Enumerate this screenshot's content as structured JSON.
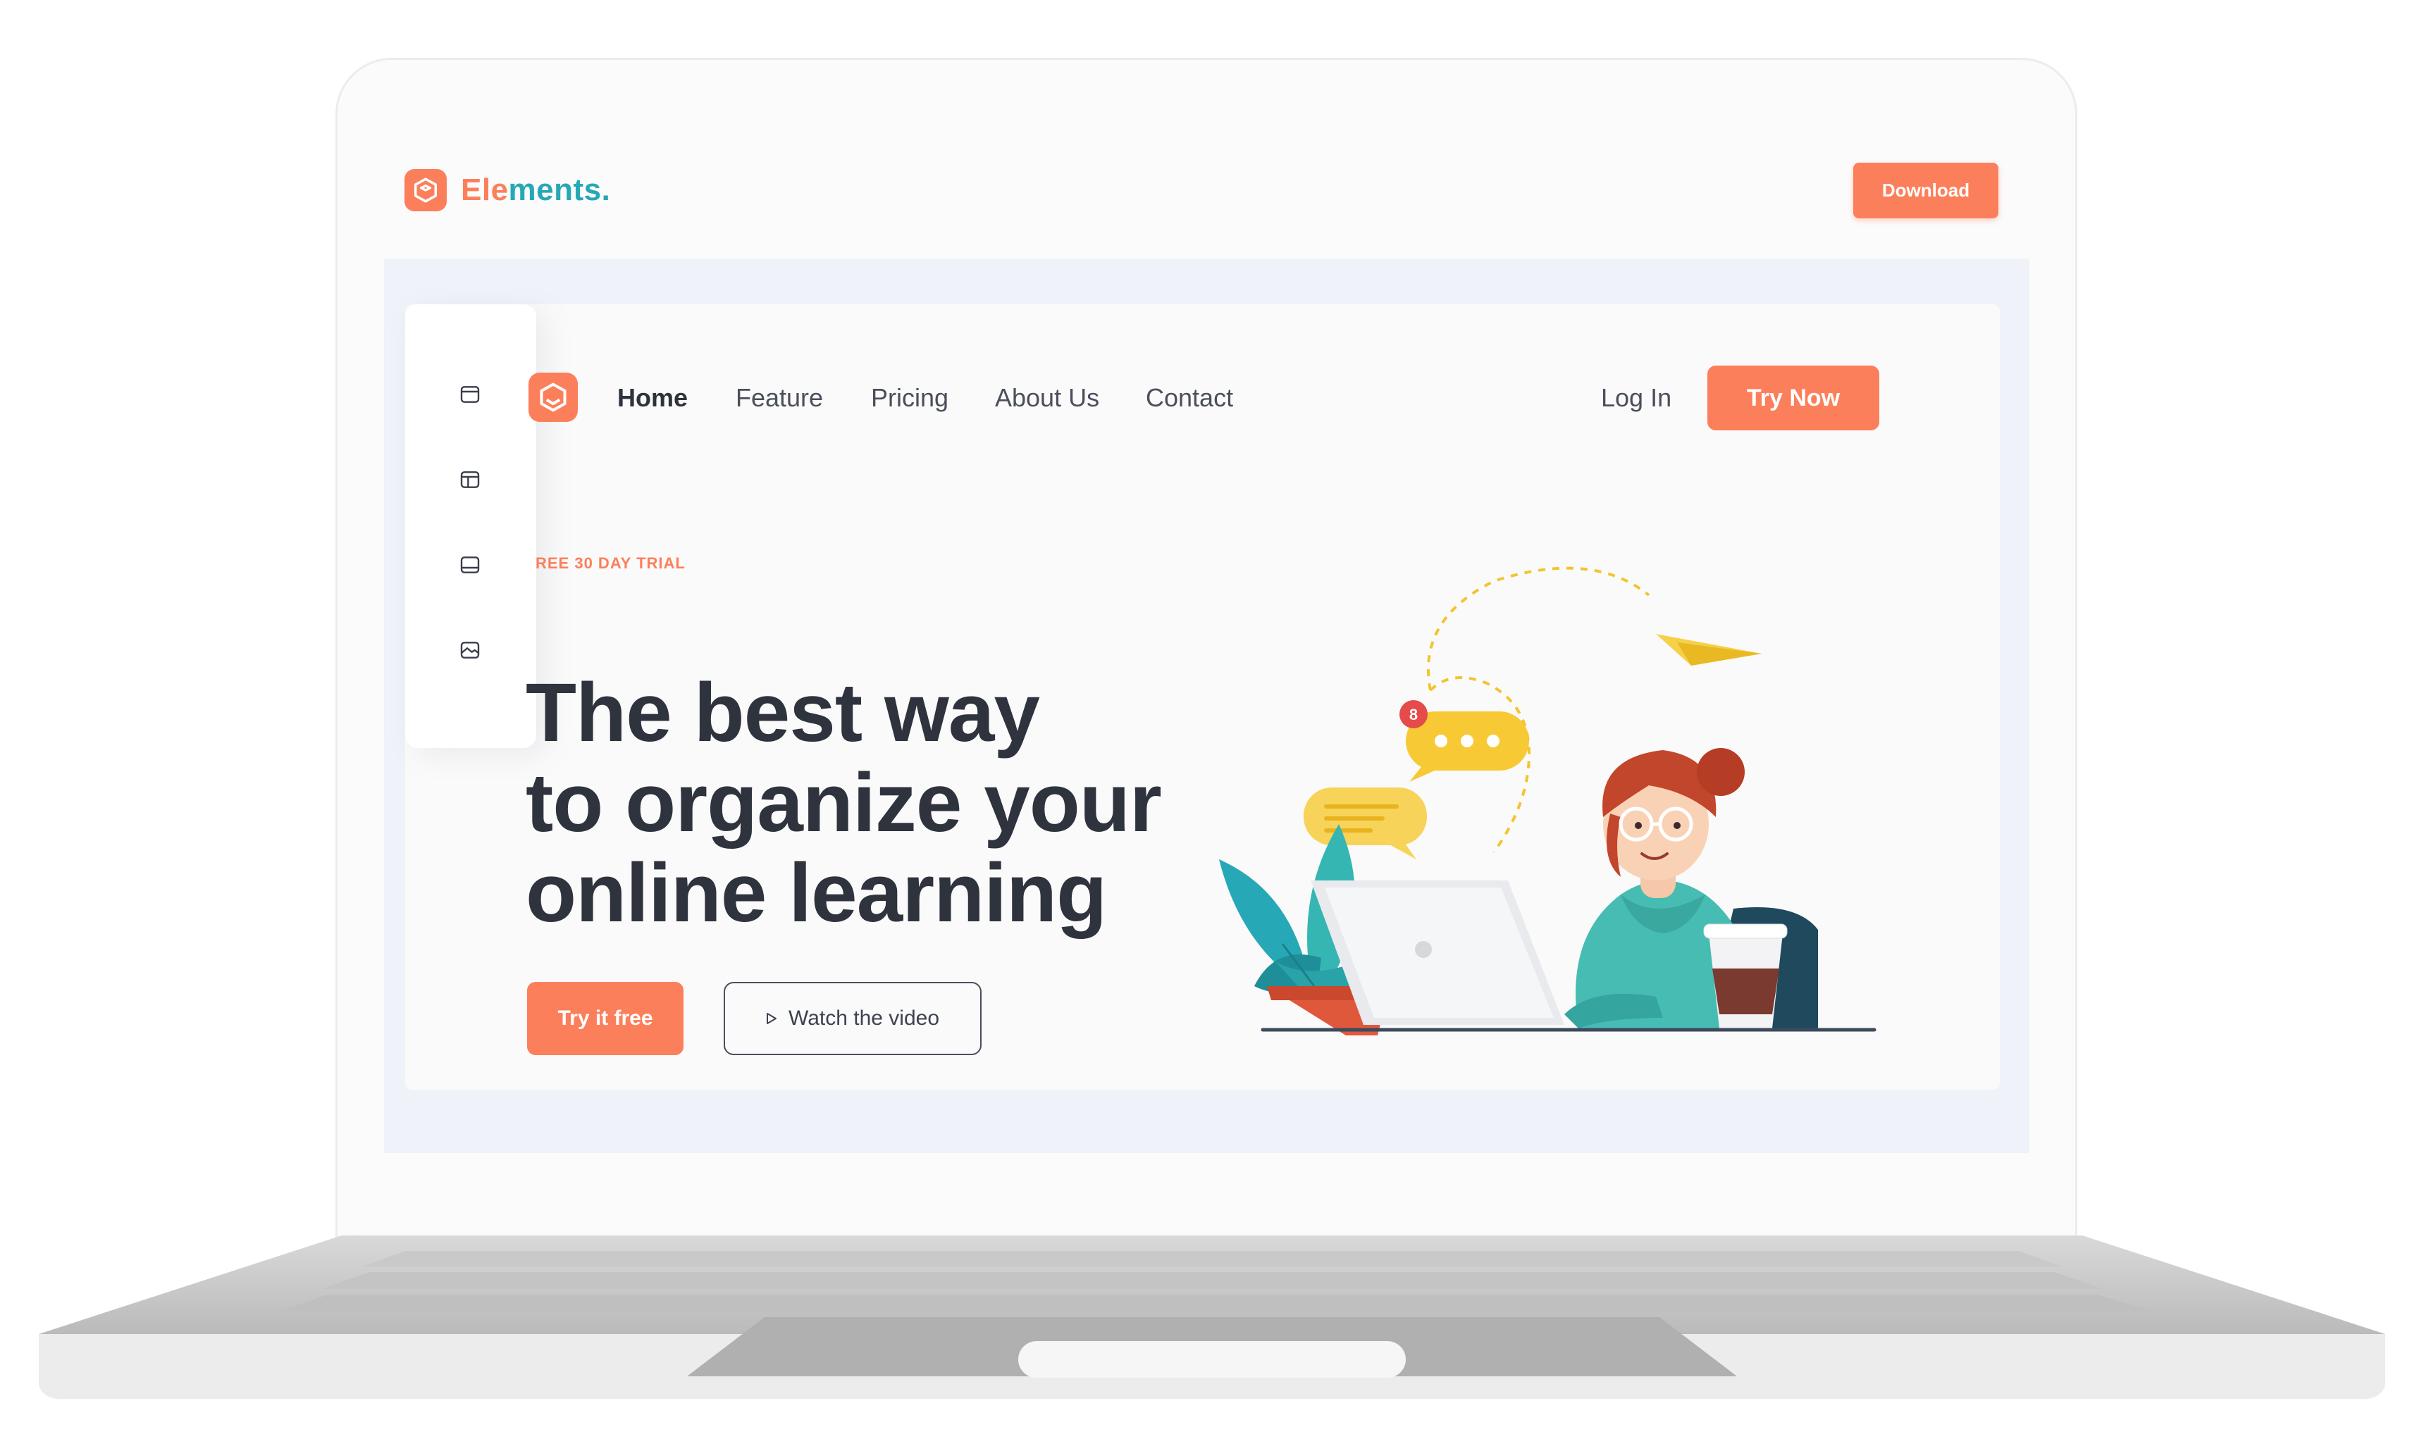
{
  "app": {
    "brand_part1": "Ele",
    "brand_part2": "ments.",
    "download_label": "Download"
  },
  "toolbar": {
    "items": [
      {
        "icon": "layout-header-icon"
      },
      {
        "icon": "layout-grid-icon"
      },
      {
        "icon": "layout-footer-icon"
      },
      {
        "icon": "image-icon"
      }
    ]
  },
  "site": {
    "nav": [
      "Home",
      "Feature",
      "Pricing",
      "About Us",
      "Contact"
    ],
    "active_nav": "Home",
    "login_label": "Log In",
    "cta_label": "Try Now"
  },
  "hero": {
    "badge": "REE 30 DAY TRIAL",
    "headline_lines": [
      "The best way",
      "to organize your",
      "online learning"
    ],
    "primary_button": "Try it free",
    "secondary_button": "Watch the video"
  },
  "illustration": {
    "notification_count": "8"
  },
  "colors": {
    "accent": "#fc7f5b",
    "teal": "#27a8b6",
    "dark_text": "#2f333d",
    "canvas_bg": "#eff2f8"
  }
}
